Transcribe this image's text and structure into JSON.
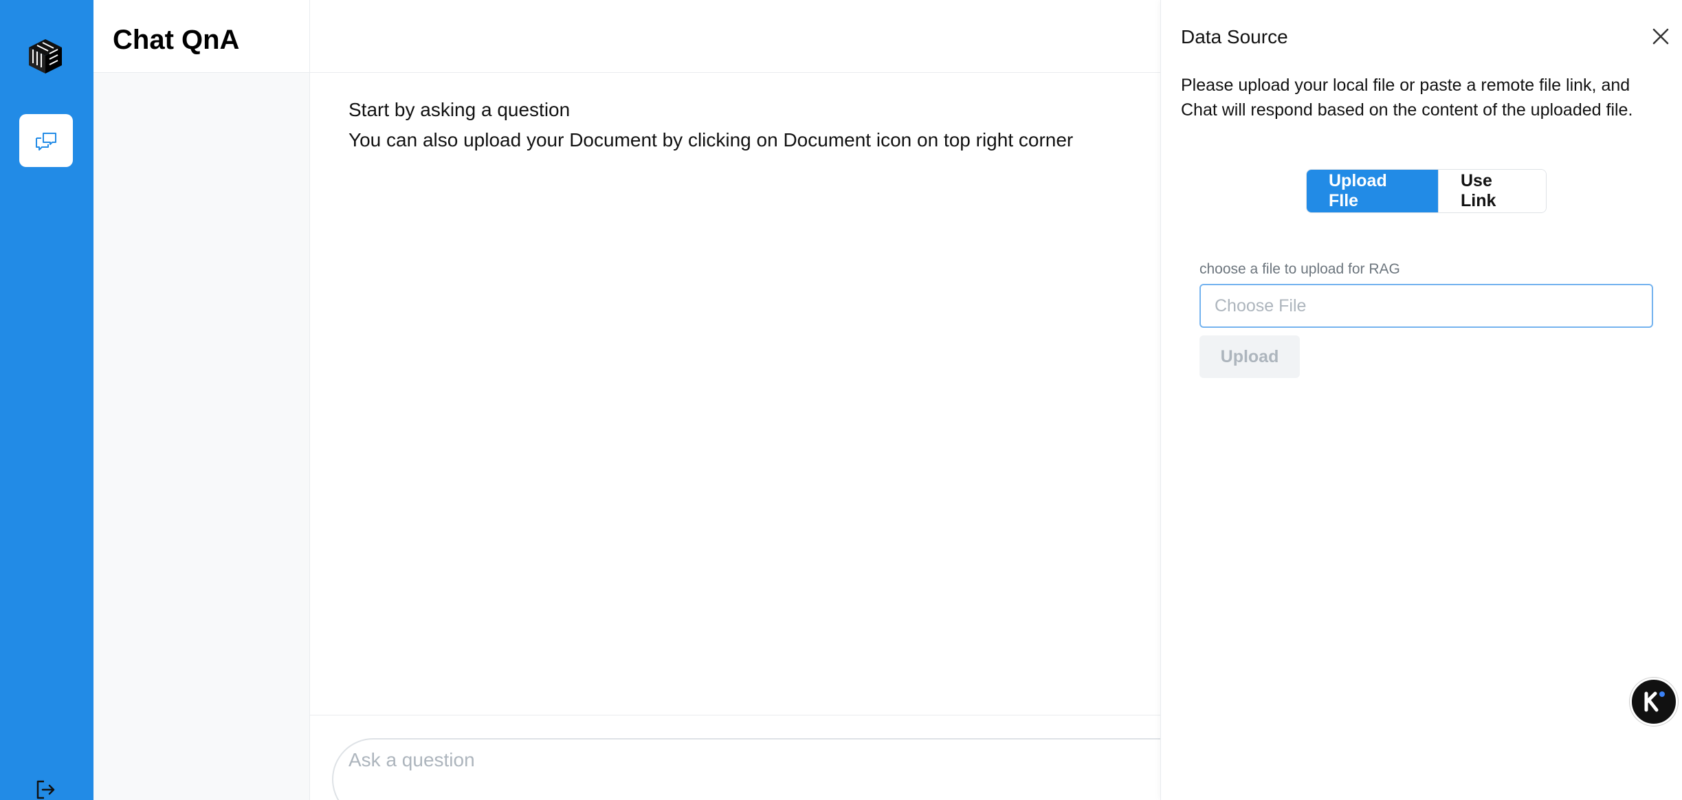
{
  "colors": {
    "primary": "#228be6",
    "sidebar_bg": "#f8f9fa",
    "muted": "#adb5bd"
  },
  "rail": {
    "logo_icon": "cube-logo-icon",
    "chat_icon": "chat-bubbles-icon",
    "logout_icon": "logout-icon"
  },
  "sidebar": {
    "title": "Chat QnA"
  },
  "main": {
    "intro_line1": "Start by asking a question",
    "intro_line2": "You can also upload your Document by clicking on Document icon on top right corner",
    "composer_placeholder": "Ask a question"
  },
  "drawer": {
    "title": "Data Source",
    "close_icon": "close-icon",
    "description": "Please upload your local file or paste a remote file link, and Chat will respond based on the content of the uploaded file.",
    "tabs": [
      {
        "label": "Upload FIle",
        "active": true
      },
      {
        "label": "Use Link",
        "active": false
      }
    ],
    "file_label": "choose a file to upload for RAG",
    "file_placeholder": "Choose File",
    "upload_label": "Upload",
    "badge_icon": "k-assistant-icon"
  }
}
